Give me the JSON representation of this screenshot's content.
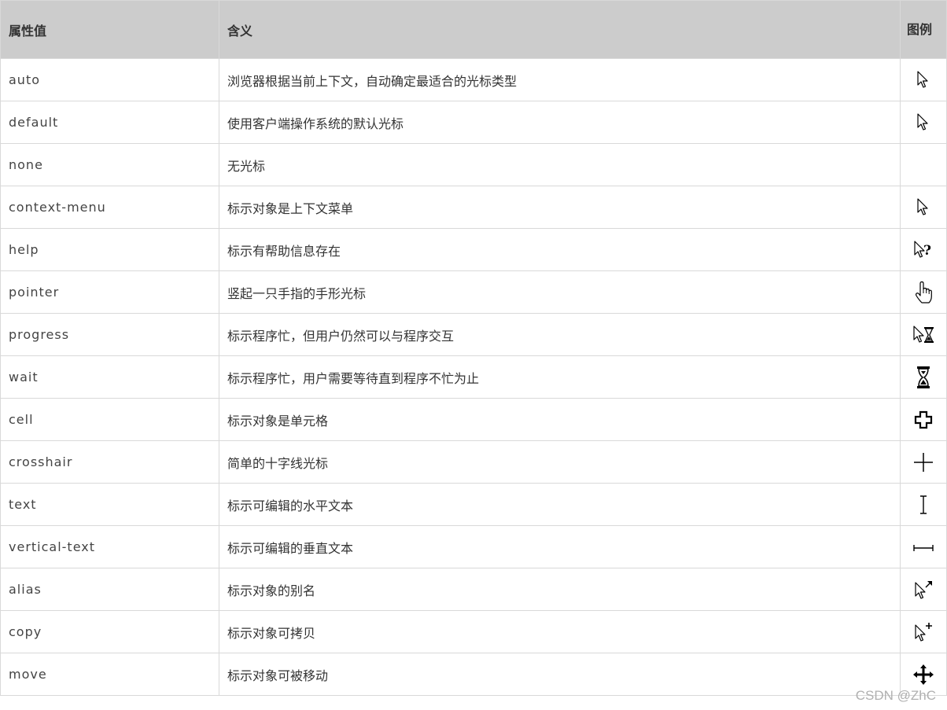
{
  "table": {
    "headers": {
      "value": "属性值",
      "meaning": "含义",
      "icon": "图例"
    },
    "rows": [
      {
        "value": "auto",
        "meaning": "浏览器根据当前上下文，自动确定最适合的光标类型",
        "icon": "arrow-cursor-icon"
      },
      {
        "value": "default",
        "meaning": "使用客户端操作系统的默认光标",
        "icon": "arrow-cursor-icon"
      },
      {
        "value": "none",
        "meaning": "无光标",
        "icon": ""
      },
      {
        "value": "context-menu",
        "meaning": "标示对象是上下文菜单",
        "icon": "arrow-cursor-icon"
      },
      {
        "value": "help",
        "meaning": "标示有帮助信息存在",
        "icon": "help-cursor-icon"
      },
      {
        "value": "pointer",
        "meaning": "竖起一只手指的手形光标",
        "icon": "hand-pointer-icon"
      },
      {
        "value": "progress",
        "meaning": "标示程序忙，但用户仍然可以与程序交互",
        "icon": "progress-cursor-icon"
      },
      {
        "value": "wait",
        "meaning": "标示程序忙，用户需要等待直到程序不忙为止",
        "icon": "hourglass-icon"
      },
      {
        "value": "cell",
        "meaning": "标示对象是单元格",
        "icon": "cell-cross-icon"
      },
      {
        "value": "crosshair",
        "meaning": "简单的十字线光标",
        "icon": "crosshair-icon"
      },
      {
        "value": "text",
        "meaning": "标示可编辑的水平文本",
        "icon": "text-ibeam-icon"
      },
      {
        "value": "vertical-text",
        "meaning": "标示可编辑的垂直文本",
        "icon": "vertical-text-icon"
      },
      {
        "value": "alias",
        "meaning": "标示对象的别名",
        "icon": "alias-cursor-icon"
      },
      {
        "value": "copy",
        "meaning": "标示对象可拷贝",
        "icon": "copy-cursor-icon"
      },
      {
        "value": "move",
        "meaning": "标示对象可被移动",
        "icon": "move-cursor-icon"
      }
    ]
  },
  "watermark": "CSDN @ZhC"
}
